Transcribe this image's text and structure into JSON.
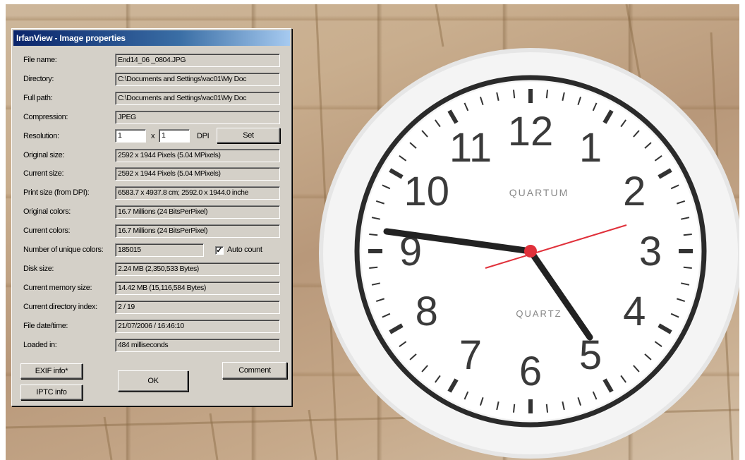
{
  "dialog": {
    "title": "IrfanView - Image properties",
    "rows": [
      {
        "label": "File name:",
        "value": "End14_06 _0804.JPG"
      },
      {
        "label": "Directory:",
        "value": "C:\\Documents and Settings\\vac01\\My Doc"
      },
      {
        "label": "Full path:",
        "value": "C:\\Documents and Settings\\vac01\\My Doc"
      },
      {
        "label": "Compression:",
        "value": "JPEG"
      },
      {
        "label": "Resolution:",
        "value": ""
      },
      {
        "label": "Original size:",
        "value": "2592 x 1944  Pixels (5.04 MPixels)"
      },
      {
        "label": "Current size:",
        "value": "2592 x 1944  Pixels (5.04 MPixels)"
      },
      {
        "label": "Print size (from DPI):",
        "value": "6583.7 x 4937.8 cm; 2592.0 x 1944.0 inche"
      },
      {
        "label": "Original colors:",
        "value": "16.7 Millions  (24 BitsPerPixel)"
      },
      {
        "label": "Current colors:",
        "value": "16.7 Millions  (24 BitsPerPixel)"
      },
      {
        "label": "Number of unique colors:",
        "value": "185015"
      },
      {
        "label": "Disk size:",
        "value": "2.24 MB (2,350,533 Bytes)"
      },
      {
        "label": "Current memory size:",
        "value": "14.42  MB (15,116,584 Bytes)"
      },
      {
        "label": "Current directory index:",
        "value": "2  /  19"
      },
      {
        "label": "File date/time:",
        "value": "21/07/2006 / 16:46:10"
      },
      {
        "label": "Loaded in:",
        "value": "484 milliseconds"
      }
    ],
    "resolution": {
      "x": "1",
      "sep": "x",
      "y": "1",
      "unit": "DPI",
      "set_label": "Set"
    },
    "auto_count": {
      "label": "Auto count",
      "checked": true,
      "mark": "✓"
    },
    "buttons": {
      "exif": "EXIF info*",
      "iptc": "IPTC info",
      "ok": "OK",
      "comment": "Comment"
    }
  },
  "clock": {
    "brand_top": "QUARTUM",
    "brand_bottom": "QUARTZ",
    "numerals": [
      "12",
      "1",
      "2",
      "3",
      "4",
      "5",
      "6",
      "7",
      "8",
      "9",
      "10",
      "11"
    ],
    "colors": {
      "face": "#ffffff",
      "numerals": "#3a3a3a",
      "second_hand": "#e0303a"
    }
  },
  "colors": {
    "titlebar_start": "#0a246a",
    "titlebar_end": "#a6caf0",
    "dialog_bg": "#d4d0c8"
  }
}
